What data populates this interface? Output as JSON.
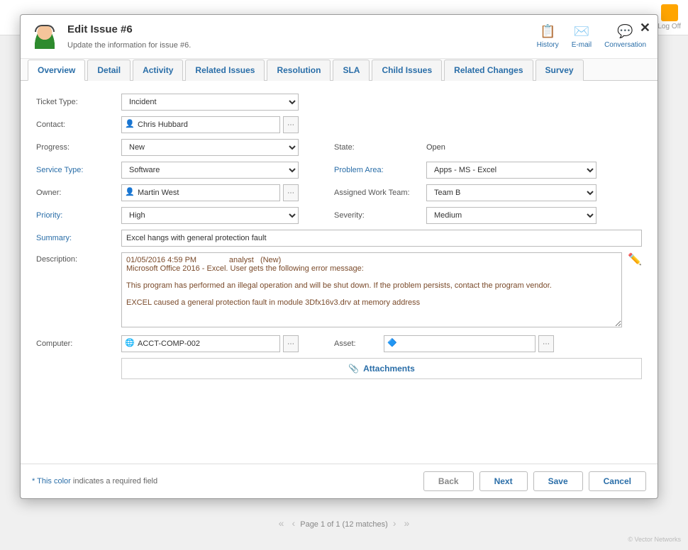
{
  "bg_toolbar": {
    "logoff": "Log Off"
  },
  "pager": {
    "text": "Page 1 of 1 (12 matches)"
  },
  "copyright": "© Vector Networks",
  "modal": {
    "title": "Edit Issue #6",
    "subtitle": "Update the information for issue #6.",
    "actions": {
      "history": "History",
      "email": "E-mail",
      "conversation": "Conversation"
    }
  },
  "tabs": [
    "Overview",
    "Detail",
    "Activity",
    "Related Issues",
    "Resolution",
    "SLA",
    "Child Issues",
    "Related Changes",
    "Survey"
  ],
  "labels": {
    "ticket_type": "Ticket Type:",
    "contact": "Contact:",
    "progress": "Progress:",
    "service_type": "Service Type:",
    "owner": "Owner:",
    "priority": "Priority:",
    "summary": "Summary:",
    "description": "Description:",
    "computer": "Computer:",
    "state": "State:",
    "problem_area": "Problem Area:",
    "assigned_team": "Assigned Work Team:",
    "severity": "Severity:",
    "asset": "Asset:"
  },
  "values": {
    "ticket_type": "Incident",
    "contact": "Chris Hubbard",
    "progress": "New",
    "service_type": "Software",
    "owner": "Martin West",
    "priority": "High",
    "summary": "Excel hangs with general protection fault",
    "description": "01/05/2016 4:59 PM               analyst   (New)\nMicrosoft Office 2016 - Excel. User gets the following error message:\n\nThis program has performed an illegal operation and will be shut down. If the problem persists, contact the program vendor.\n\nEXCEL caused a general protection fault in module 3Dfx16v3.drv at memory address",
    "computer": "ACCT-COMP-002",
    "state": "Open",
    "problem_area": "Apps - MS - Excel",
    "assigned_team": "Team B",
    "severity": "Medium",
    "asset": ""
  },
  "attachments_label": "Attachments",
  "footer": {
    "required_note_prefix": "* This color",
    "required_note_suffix": " indicates a required field",
    "back": "Back",
    "next": "Next",
    "save": "Save",
    "cancel": "Cancel"
  }
}
